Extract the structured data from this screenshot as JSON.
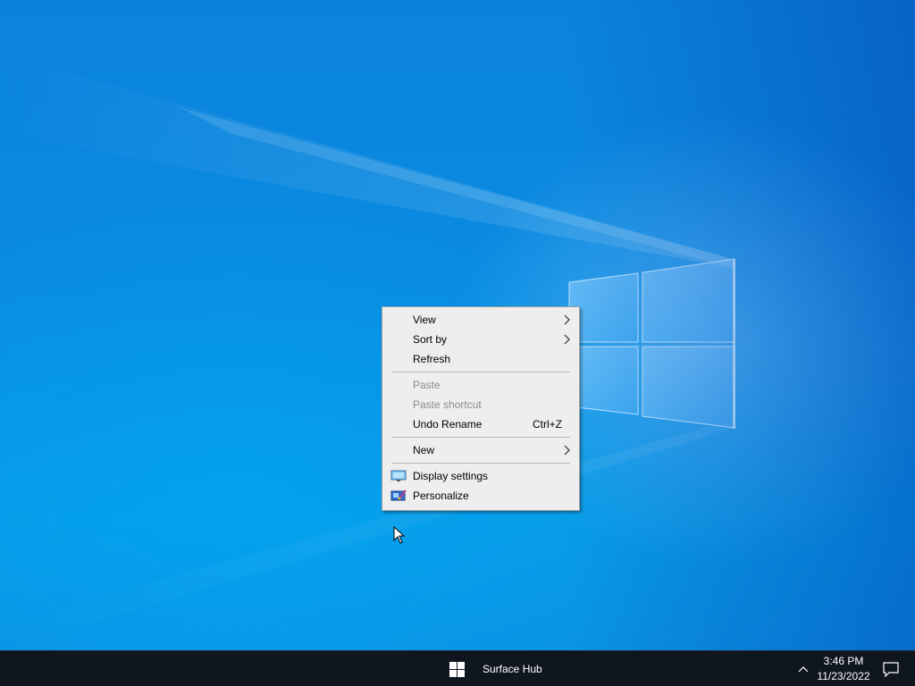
{
  "desktop": {
    "wallpaper_icon": "windows-logo-light-beams"
  },
  "context_menu": {
    "items": [
      {
        "label": "View",
        "has_submenu": true,
        "enabled": true
      },
      {
        "label": "Sort by",
        "has_submenu": true,
        "enabled": true
      },
      {
        "label": "Refresh",
        "has_submenu": false,
        "enabled": true
      },
      {
        "label": "Paste",
        "has_submenu": false,
        "enabled": false
      },
      {
        "label": "Paste shortcut",
        "has_submenu": false,
        "enabled": false
      },
      {
        "label": "Undo Rename",
        "shortcut": "Ctrl+Z",
        "has_submenu": false,
        "enabled": true
      },
      {
        "label": "New",
        "has_submenu": true,
        "enabled": true
      },
      {
        "label": "Display settings",
        "icon": "display-icon",
        "has_submenu": false,
        "enabled": true
      },
      {
        "label": "Personalize",
        "icon": "personalize-icon",
        "has_submenu": false,
        "enabled": true
      }
    ],
    "submenu_icon": "chevron-right-icon"
  },
  "taskbar": {
    "start_icon": "windows-start-icon",
    "app_label": "Surface Hub",
    "tray_icon": "chevron-up-icon",
    "time": "3:46 PM",
    "date": "11/23/2022",
    "notification_icon": "action-center-icon"
  },
  "colors": {
    "desktop_blue": "#0a83dc",
    "taskbar_bg": "#0f1620",
    "menu_bg": "#eeeeee",
    "disabled_text": "#8a8a8a"
  }
}
